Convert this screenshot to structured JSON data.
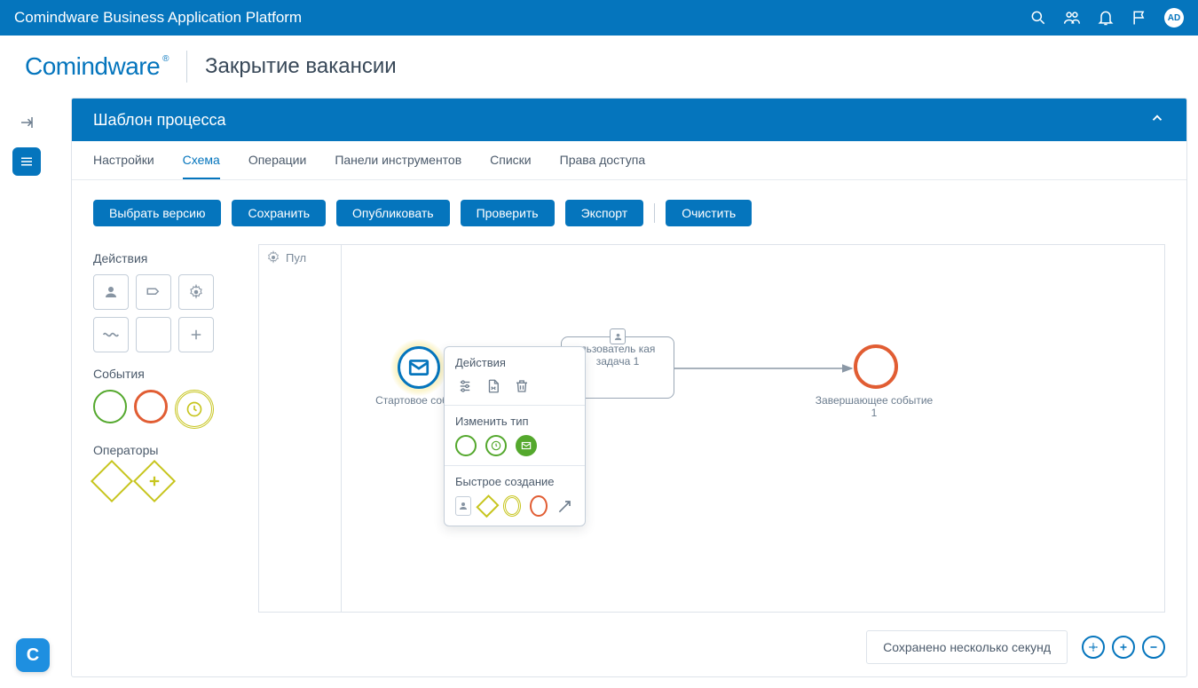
{
  "topbar": {
    "title": "Comindware Business Application Platform",
    "avatar": "AD"
  },
  "logo": "Comindware",
  "breadcrumb": "Закрытие вакансии",
  "panel_title": "Шаблон процесса",
  "tabs": {
    "settings": "Настройки",
    "scheme": "Схема",
    "operations": "Операции",
    "toolbars": "Панели инструментов",
    "lists": "Списки",
    "permissions": "Права доступа"
  },
  "buttons": {
    "select_version": "Выбрать версию",
    "save": "Сохранить",
    "publish": "Опубликовать",
    "check": "Проверить",
    "export": "Экспорт",
    "clear": "Очистить"
  },
  "palette": {
    "actions": "Действия",
    "events": "События",
    "operators": "Операторы"
  },
  "pool_label": "Пул",
  "nodes": {
    "start_label": "Стартовое соб",
    "task_text": "льзователь кая задача 1",
    "end_label1": "Завершающее событие",
    "end_label2": "1"
  },
  "context": {
    "actions": "Действия",
    "change_type": "Изменить тип",
    "quick_create": "Быстрое создание"
  },
  "status": "Сохранено несколько секунд"
}
